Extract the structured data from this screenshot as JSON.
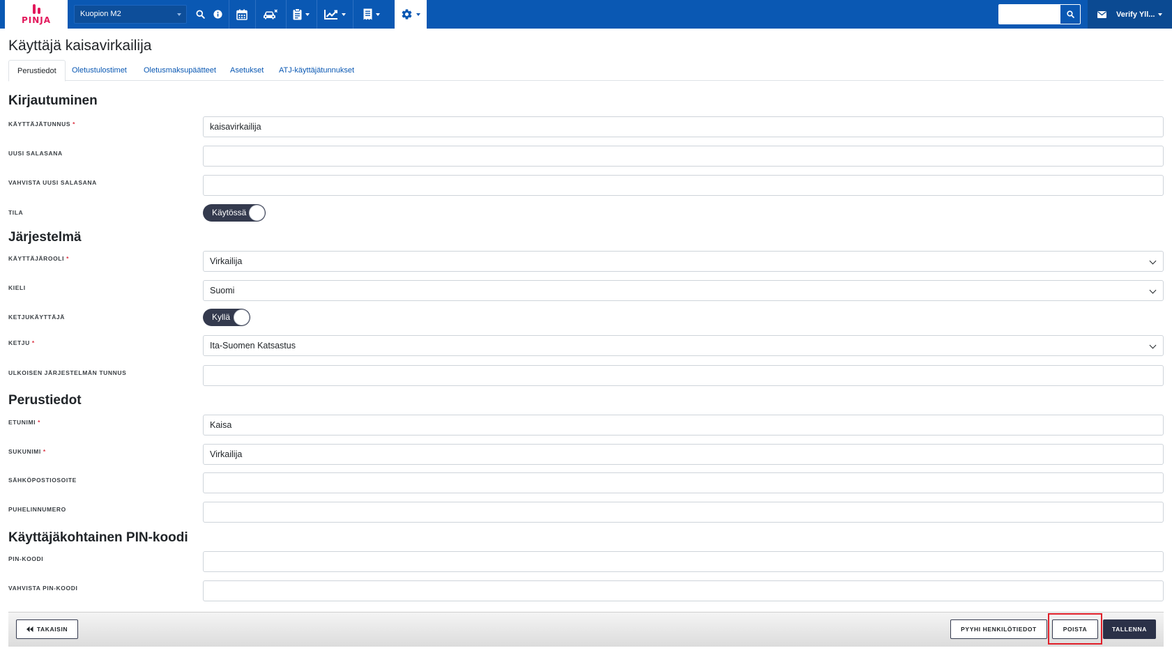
{
  "navbar": {
    "brand": "PINJA",
    "site": "Kuopion M2",
    "search_placeholder": "",
    "user": "Verify Yll..."
  },
  "page": {
    "title": "Käyttäjä kaisavirkailija",
    "tabs": [
      "Perustiedot",
      "Oletustulostimet",
      "Oletusmaksupäätteet",
      "Asetukset",
      "ATJ-käyttäjätunnukset"
    ]
  },
  "sections": {
    "login": "Kirjautuminen",
    "system": "Järjestelmä",
    "basic": "Perustiedot",
    "pin": "Käyttäjäkohtainen PIN-koodi"
  },
  "labels": {
    "username": "KÄYTTÄJÄTUNNUS",
    "new_password": "UUSI SALASANA",
    "confirm_password": "VAHVISTA UUSI SALASANA",
    "status": "TILA",
    "role": "KÄYTTÄJÄROOLI",
    "language": "KIELI",
    "chain_user": "KETJUKÄYTTÄJÄ",
    "chain": "KETJU",
    "external_id": "ULKOISEN JÄRJESTELMÄN TUNNUS",
    "first_name": "ETUNIMI",
    "last_name": "SUKUNIMI",
    "email": "SÄHKÖPOSTIOSOITE",
    "phone": "PUHELINNUMERO",
    "pin": "PIN-KOODI",
    "confirm_pin": "VAHVISTA PIN-KOODI",
    "required_mark": "*"
  },
  "values": {
    "username": "kaisavirkailija",
    "new_password": "",
    "confirm_password": "",
    "status": "Käytössä",
    "role": "Virkailija",
    "language": "Suomi",
    "chain_user": "Kyllä",
    "chain": "Ita-Suomen Katsastus",
    "external_id": "",
    "first_name": "Kaisa",
    "last_name": "Virkailija",
    "email": "",
    "phone": "",
    "pin": "",
    "confirm_pin": ""
  },
  "footer": {
    "back": "TAKAISIN",
    "clear_personal": "PYYHI HENKILÖTIEDOT",
    "delete": "POISTA",
    "save": "TALLENNA"
  },
  "colors": {
    "navbar": "#0a58b3",
    "brand": "#e2185b",
    "toggle": "#343a4e",
    "save_button": "#2b3148",
    "highlight": "#e0202a"
  }
}
